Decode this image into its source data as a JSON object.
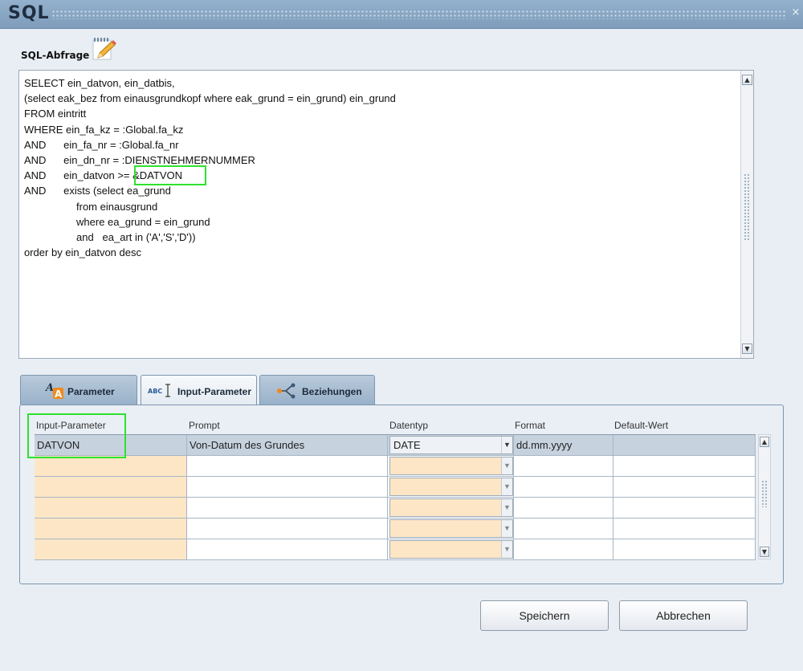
{
  "window": {
    "title": "SQL",
    "close_glyph": "×"
  },
  "sql_section": {
    "label": "SQL-Abfrage",
    "query": "SELECT ein_datvon, ein_datbis,\n(select eak_bez from einausgrundkopf where eak_grund = ein_grund) ein_grund\nFROM eintritt\nWHERE ein_fa_kz = :Global.fa_kz\nAND      ein_fa_nr = :Global.fa_nr\nAND      ein_dn_nr = :DIENSTNEHMERNUMMER\nAND      ein_datvon >= &DATVON\nAND      exists (select ea_grund\n                  from einausgrund\n                  where ea_grund = ein_grund\n                  and   ea_art in ('A','S','D'))\norder by ein_datvon desc"
  },
  "tabs": [
    {
      "label": "Parameter",
      "icon": "font-style-icon",
      "active": false
    },
    {
      "label": "Input-Parameter",
      "icon": "abc-text-cursor-icon",
      "active": true
    },
    {
      "label": "Beziehungen",
      "icon": "relation-branch-icon",
      "active": false
    }
  ],
  "grid": {
    "columns": [
      "Input-Parameter",
      "Prompt",
      "Datentyp",
      "Format",
      "Default-Wert"
    ],
    "rows": [
      {
        "input_parameter": "DATVON",
        "prompt": "Von-Datum des Grundes",
        "datentyp": "DATE",
        "format": "dd.mm.yyyy",
        "default_wert": ""
      },
      {
        "input_parameter": "",
        "prompt": "",
        "datentyp": "",
        "format": "",
        "default_wert": ""
      },
      {
        "input_parameter": "",
        "prompt": "",
        "datentyp": "",
        "format": "",
        "default_wert": ""
      },
      {
        "input_parameter": "",
        "prompt": "",
        "datentyp": "",
        "format": "",
        "default_wert": ""
      },
      {
        "input_parameter": "",
        "prompt": "",
        "datentyp": "",
        "format": "",
        "default_wert": ""
      },
      {
        "input_parameter": "",
        "prompt": "",
        "datentyp": "",
        "format": "",
        "default_wert": ""
      }
    ]
  },
  "buttons": {
    "save": "Speichern",
    "cancel": "Abbrechen"
  },
  "colors": {
    "highlight": "#2ee22e",
    "empty_param_bg": "#fde6c6",
    "selected_row_bg": "#c7d2df",
    "titlebar": "#8aa8c5"
  }
}
